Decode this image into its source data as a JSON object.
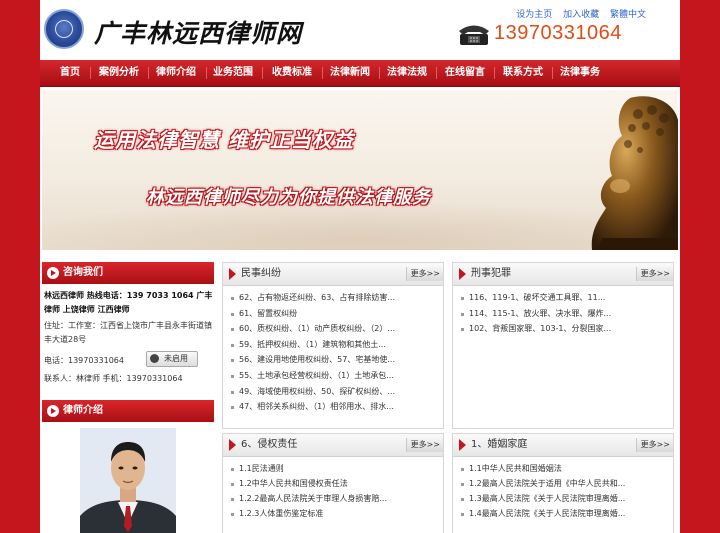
{
  "header": {
    "site_title": "广丰林远西律师网",
    "top_links": [
      "设为主页",
      "加入收藏",
      "繁體中文"
    ],
    "phone": "13970331064",
    "emblem_text": "中国律师"
  },
  "nav": {
    "items": [
      "首页",
      "案例分析",
      "律师介绍",
      "业务范围",
      "收费标准",
      "法律新闻",
      "法律法规",
      "在线留言",
      "联系方式",
      "法律事务"
    ]
  },
  "banner": {
    "slogan1": "运用法律智慧 维护正当权益",
    "slogan2": "林远西律师尽力为你提供法律服务"
  },
  "sidebar": {
    "consult_title": "咨询我们",
    "contact_headline": "林远西律师 热线电话：139 7033 1064 广丰律师 上饶律师 江西律师",
    "address": "住址：工作室：江西省上饶市广丰县永丰街道镇丰大道28号",
    "phone_line": "电话：13970331064",
    "qq_status": "未启用",
    "contact_person": "联系人：林律师 手机：13970331064",
    "lawyer_title": "律师介绍"
  },
  "boxes": {
    "civil": {
      "title": "民事纠纷",
      "more": "更多>>",
      "items": [
        "62、占有物返还纠纷、63、占有排除妨害...",
        "61、留置权纠纷",
        "60、质权纠纷、（1）动产质权纠纷、（2）...",
        "59、抵押权纠纷、（1）建筑物和其他土...",
        "56、建设用地使用权纠纷、57、宅基地使...",
        "55、土地承包经营权纠纷、（1）土地承包...",
        "49、海域使用权纠纷、50、探矿权纠纷、...",
        "47、相邻关系纠纷、（1）相邻用水、排水..."
      ]
    },
    "criminal": {
      "title": "刑事犯罪",
      "more": "更多>>",
      "items": [
        "116、119-1、破坏交通工具罪、11...",
        "114、115-1、放火罪、决水罪、爆炸...",
        "102、背叛国家罪、103-1、分裂国家..."
      ]
    },
    "tort": {
      "title": "6、侵权责任",
      "more": "更多>>",
      "items": [
        "1.1民法通则",
        "1.2中华人民共和国侵权责任法",
        "1.2.2最高人民法院关于审理人身损害赔...",
        "1.2.3人体重伤鉴定标准"
      ]
    },
    "family": {
      "title": "1、婚姻家庭",
      "more": "更多>>",
      "items": [
        "1.1中华人民共和国婚姻法",
        "1.2最高人民法院关于适用《中华人民共和...",
        "1.3最高人民法院《关于人民法院审理离婚...",
        "1.4最高人民法院《关于人民法院审理离婚..."
      ]
    }
  }
}
